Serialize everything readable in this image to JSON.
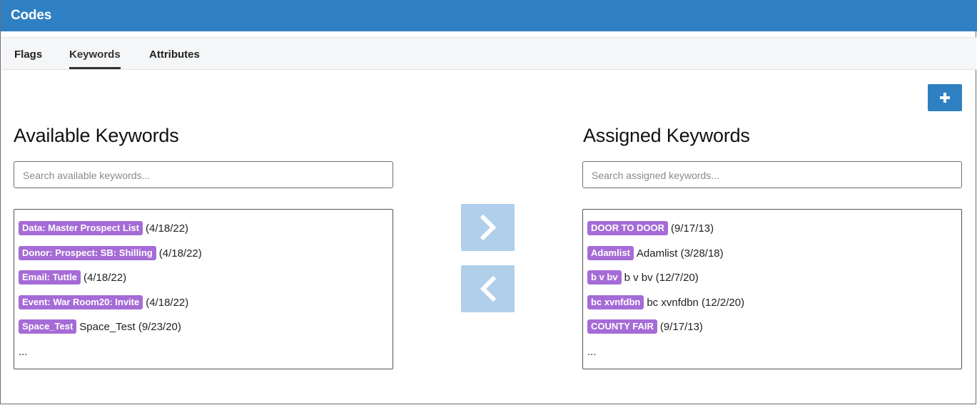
{
  "window": {
    "title": "Codes"
  },
  "tabs": [
    {
      "label": "Flags"
    },
    {
      "label": "Keywords"
    },
    {
      "label": "Attributes"
    }
  ],
  "active_tab": "Keywords",
  "toolbar": {
    "add_icon": "plus-icon"
  },
  "available": {
    "heading": "Available Keywords",
    "search_placeholder": "Search available keywords...",
    "items": [
      {
        "badge": "Data: Master Prospect List",
        "text": "(4/18/22)"
      },
      {
        "badge": "Donor: Prospect: SB: Shilling",
        "text": "(4/18/22)"
      },
      {
        "badge": "Email: Tuttle",
        "text": "(4/18/22)"
      },
      {
        "badge": "Event: War Room20: Invite",
        "text": "(4/18/22)"
      },
      {
        "badge": "Space_Test",
        "text": "Space_Test (9/23/20)"
      }
    ],
    "more": "..."
  },
  "assigned": {
    "heading": "Assigned Keywords",
    "search_placeholder": "Search assigned keywords...",
    "items": [
      {
        "badge": "DOOR TO DOOR",
        "text": "(9/17/13)"
      },
      {
        "badge": "Adamlist",
        "text": "Adamlist (3/28/18)"
      },
      {
        "badge": "b v bv",
        "text": "b v bv (12/7/20)"
      },
      {
        "badge": "bc xvnfdbn",
        "text": "bc xvnfdbn (12/2/20)"
      },
      {
        "badge": "COUNTY FAIR",
        "text": "(9/17/13)"
      }
    ],
    "more": "..."
  },
  "transfer": {
    "assign_icon": "chevron-right-icon",
    "unassign_icon": "chevron-left-icon"
  },
  "colors": {
    "header": "#2f80c3",
    "badge": "#a56bd6",
    "transfer_button": "#b0cfea"
  }
}
